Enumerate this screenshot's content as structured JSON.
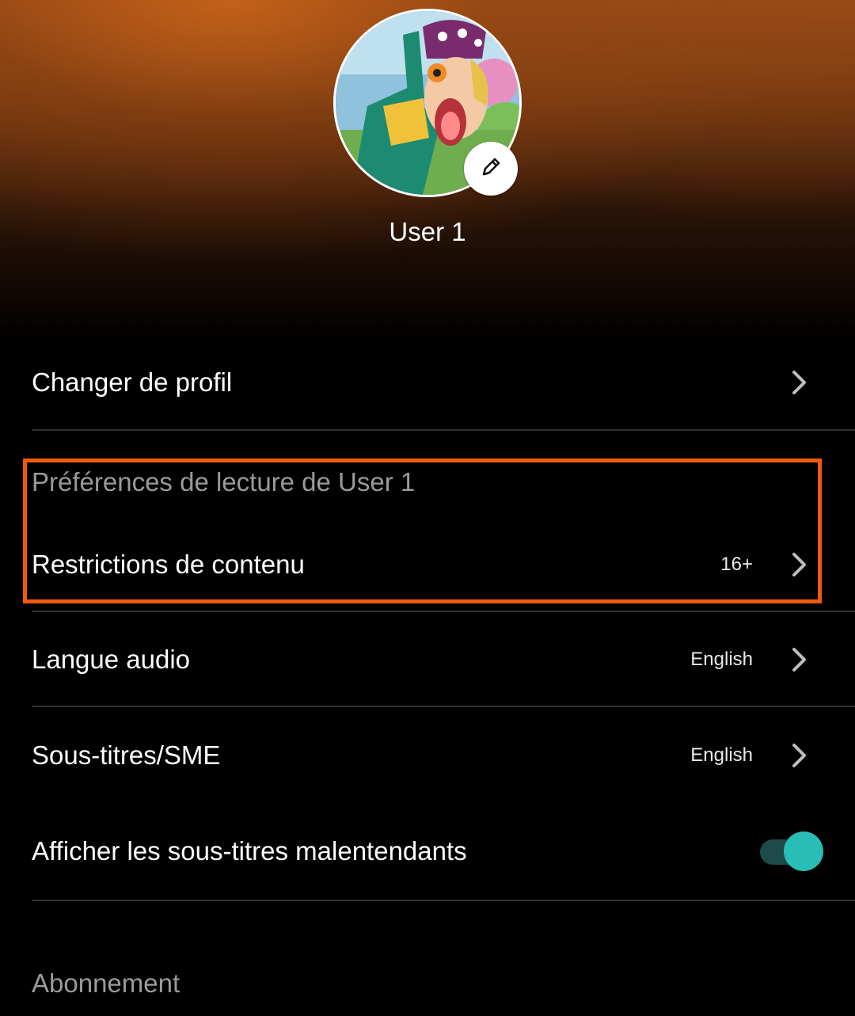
{
  "profile": {
    "name": "User 1"
  },
  "menu": {
    "change_profile_label": "Changer de profil",
    "playback_section_title": "Préférences de lecture de User 1",
    "content_restrictions": {
      "label": "Restrictions de contenu",
      "value": "16+"
    },
    "audio_language": {
      "label": "Langue audio",
      "value": "English"
    },
    "subtitles": {
      "label": "Sous-titres/SME",
      "value": "English"
    },
    "show_sdh": {
      "label": "Afficher les sous-titres malentendants",
      "enabled": true
    },
    "subscription_section_title": "Abonnement"
  },
  "colors": {
    "highlight": "#f25a0c",
    "toggle_on": "#2abdb6",
    "header_accent": "#c4621a"
  },
  "icons": [
    "pencil-icon",
    "chevron-right-icon"
  ]
}
